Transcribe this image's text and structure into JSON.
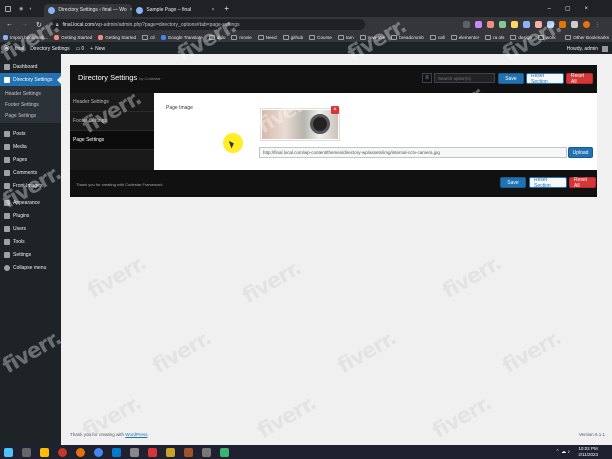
{
  "browser": {
    "tabs": [
      {
        "title": "Directory Settings ‹ final — Wo",
        "active": true
      },
      {
        "title": "Sample Page – final",
        "active": false
      }
    ],
    "url": {
      "host": "final.local.com",
      "path": "/wp-admin/admin.php?page=directory_options#tab=page-settings"
    },
    "bookmarks": [
      "Import bookmark...",
      "Getting Started",
      "Getting Started",
      "ctl",
      "Google Translate",
      "dido",
      "movie",
      "Need",
      "github",
      "Course",
      "tam",
      "new-tem",
      "breadcrumb",
      "call",
      "elementor",
      "ra ols",
      "design",
      "work",
      "Other Bookmarks"
    ]
  },
  "adminbar": {
    "site": "final",
    "plugin": "Directory Settings",
    "comments": "0",
    "new": "New",
    "user": "Howdy, admin"
  },
  "sidebar": {
    "items": [
      {
        "label": "Dashboard",
        "icon": "dashboard-icon"
      },
      {
        "label": "Directory Settings",
        "icon": "gear-icon",
        "current": true
      },
      {
        "label": "Posts",
        "icon": "pin-icon"
      },
      {
        "label": "Media",
        "icon": "media-icon"
      },
      {
        "label": "Pages",
        "icon": "pages-icon"
      },
      {
        "label": "Comments",
        "icon": "comment-icon"
      },
      {
        "label": "Front Images",
        "icon": "image-icon"
      },
      {
        "label": "Appearance",
        "icon": "brush-icon"
      },
      {
        "label": "Plugins",
        "icon": "plugin-icon"
      },
      {
        "label": "Users",
        "icon": "user-icon"
      },
      {
        "label": "Tools",
        "icon": "wrench-icon"
      },
      {
        "label": "Settings",
        "icon": "settings-icon"
      },
      {
        "label": "Collapse menu",
        "icon": "collapse-icon"
      }
    ],
    "submenu": [
      "Header Settings",
      "Footer Settings",
      "Page Settings"
    ]
  },
  "panel": {
    "title": "Directory Settings",
    "subtitle": "by Codestar",
    "search_placeholder": "Search option(s)",
    "save": "Save",
    "reset_section": "Reset Section",
    "reset_all": "Reset All",
    "nav": [
      "Header Settings",
      "Footer Settings",
      "Page Settings"
    ],
    "field_label": "Page Image",
    "image_url": "http://final.local.com/wp-content/themes/directory-wp/assets/img/internal-cctv-camera.jpg",
    "upload": "Upload",
    "remove": "×",
    "thanks": "Thank you for creating with Codestar Framework"
  },
  "footer": {
    "thanks": "Thank you for creating with",
    "wp_link": "WordPress",
    "version": "Version 6.1.1"
  },
  "taskbar": {
    "time": "10:02 PM",
    "date": "2/11/2023"
  },
  "watermark": "fiverr.",
  "colors": {
    "wp_blue": "#2271b1",
    "wp_dark": "#1d2327",
    "danger": "#d63638"
  }
}
